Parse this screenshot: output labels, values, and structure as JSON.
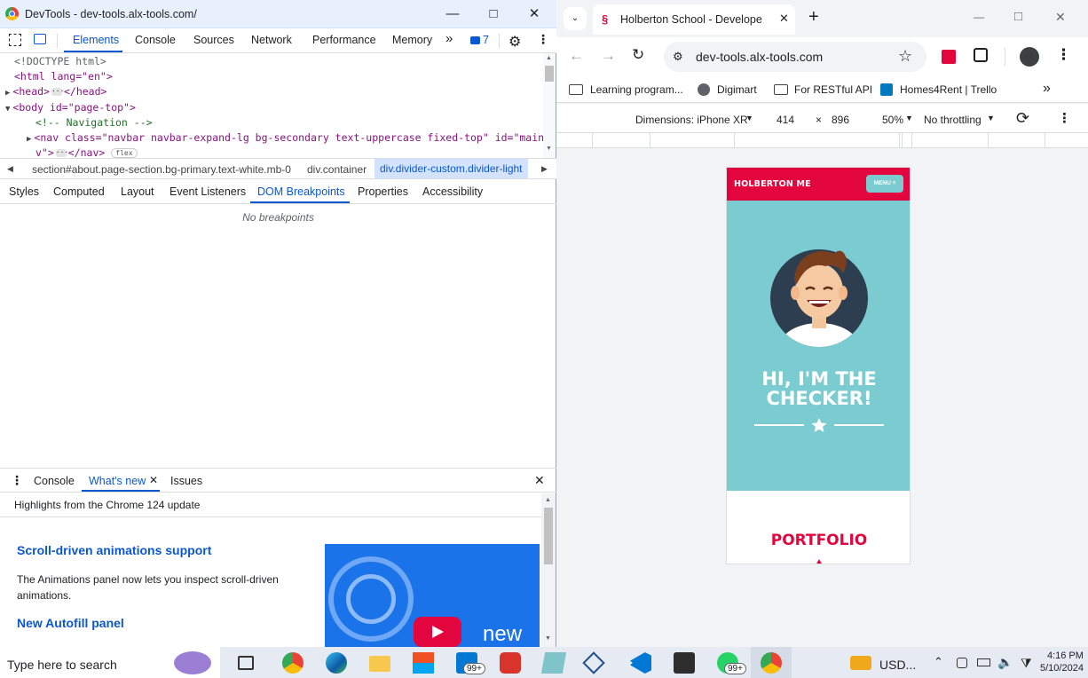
{
  "devtools": {
    "window_title": "DevTools - dev-tools.alx-tools.com/",
    "tabs": [
      "Elements",
      "Console",
      "Sources",
      "Network",
      "Performance",
      "Memory"
    ],
    "more_tabs": "»",
    "issues_count": "7",
    "dom_lines": [
      "<!DOCTYPE html>",
      "<html lang=\"en\">",
      "<head>",
      "</head>",
      "<body id=\"page-top\">",
      "<!-- Navigation -->",
      "<nav class=\"navbar navbar-expand-lg bg-secondary text-uppercase fixed-top\" id=\"mainNa",
      "v\">",
      "</nav>",
      "flex"
    ],
    "breadcrumbs": [
      "section#about.page-section.bg-primary.text-white.mb-0",
      "div.container",
      "div.divider-custom.divider-light"
    ],
    "subtabs": [
      "Styles",
      "Computed",
      "Layout",
      "Event Listeners",
      "DOM Breakpoints",
      "Properties",
      "Accessibility"
    ],
    "no_breakpoints": "No breakpoints",
    "drawer_tabs": [
      "Console",
      "What's new",
      "Issues"
    ],
    "highlights": "Highlights from the Chrome 124 update",
    "whatsnew": {
      "h1": "Scroll-driven animations support",
      "p1": "The Animations panel now lets you inspect scroll-driven animations.",
      "h2": "New Autofill panel",
      "promo": "new"
    }
  },
  "chrome": {
    "tab_title": "Holberton School - Developer t",
    "url": "dev-tools.alx-tools.com",
    "bookmarks": [
      "Learning program...",
      "Digimart",
      "For RESTful API",
      "Homes4Rent | Trello"
    ],
    "device": "Dimensions: iPhone XR",
    "width": "414",
    "times": "×",
    "height": "896",
    "zoom": "50%",
    "throttle": "No throttling"
  },
  "page": {
    "brand": "HOLBERTON ME",
    "menu": "MENU ≡",
    "hero_line1": "HI, I'M THE",
    "hero_line2": "CHECKER!",
    "portfolio": "PORTFOLIO"
  },
  "taskbar": {
    "search": "Type here to search",
    "badge1": "99+",
    "badge2": "99+",
    "usd": "USD...",
    "time": "4:16 PM",
    "date": "5/10/2024"
  },
  "colors": {
    "brand_red": "#e3053e",
    "teal": "#7accd1",
    "devtools_blue": "#0b57d0"
  }
}
